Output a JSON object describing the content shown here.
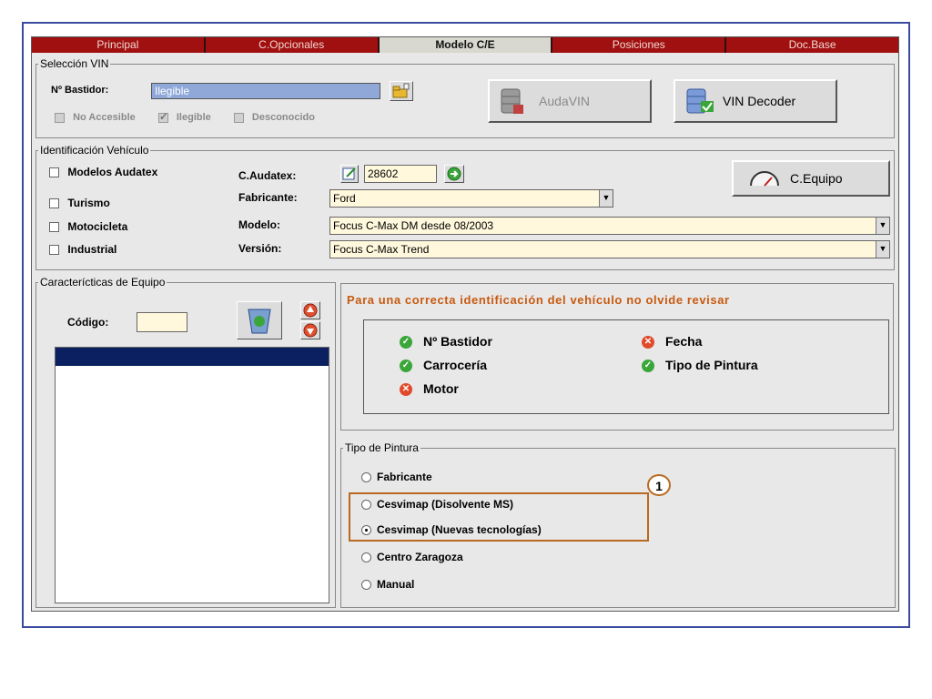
{
  "tabs": [
    {
      "label": "Principal",
      "active": false
    },
    {
      "label": "C.Opcionales",
      "active": false
    },
    {
      "label": "Modelo C/E",
      "active": true
    },
    {
      "label": "Posiciones",
      "active": false
    },
    {
      "label": "Doc.Base",
      "active": false
    }
  ],
  "vin": {
    "legend": "Selección VIN",
    "bastidor_label": "Nº Bastidor:",
    "bastidor_value": "Ilegible",
    "audavin_label": "AudaVIN",
    "decoder_label": "VIN Decoder",
    "status_options": [
      {
        "label": "No Accesible",
        "checked": false
      },
      {
        "label": "Ilegible",
        "checked": true
      },
      {
        "label": "Desconocido",
        "checked": false
      }
    ]
  },
  "vehiculo": {
    "legend": "Identificación Vehículo",
    "types": [
      {
        "label": "Modelos Audatex"
      },
      {
        "label": "Turismo"
      },
      {
        "label": "Motocicleta"
      },
      {
        "label": "Industrial"
      }
    ],
    "caudatex_label": "C.Audatex:",
    "caudatex_value": "28602",
    "fabricante_label": "Fabricante:",
    "fabricante_value": "Ford",
    "modelo_label": "Modelo:",
    "modelo_value": "Focus C-Max DM desde 08/2003",
    "version_label": "Versión:",
    "version_value": "Focus C-Max Trend",
    "cequipo_label": "C.Equipo"
  },
  "caracteristicas": {
    "legend": "Caracterícticas de Equipo",
    "codigo_label": "Código:",
    "codigo_value": ""
  },
  "revision": {
    "heading": "Para una correcta identificación del vehículo no olvide revisar",
    "heading_color": "#c85a10",
    "items": [
      {
        "label": "Nº Bastidor",
        "status": "ok"
      },
      {
        "label": "Fecha",
        "status": "bad"
      },
      {
        "label": "Carrocería",
        "status": "ok"
      },
      {
        "label": "Tipo de Pintura",
        "status": "ok"
      },
      {
        "label": "Motor",
        "status": "bad"
      }
    ]
  },
  "pintura": {
    "legend": "Tipo de Pintura",
    "callout_number": "1",
    "callout_color": "#b86a20",
    "options": [
      {
        "label": "Fabricante",
        "selected": false
      },
      {
        "label": "Cesvimap (Disolvente MS)",
        "selected": false
      },
      {
        "label": "Cesvimap (Nuevas tecnologías)",
        "selected": true
      },
      {
        "label": "Centro Zaragoza",
        "selected": false
      },
      {
        "label": "Manual",
        "selected": false
      }
    ]
  },
  "colors": {
    "tab_bar": "#a01010",
    "frame_border": "#3a4aa0",
    "list_selected": "#0a2060",
    "bastidor_field": "#8fa8d8",
    "field_bg": "#fff8dc"
  }
}
